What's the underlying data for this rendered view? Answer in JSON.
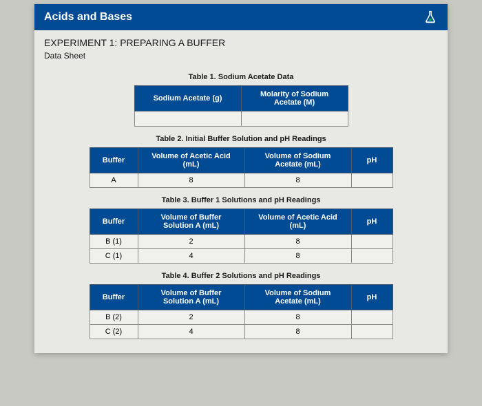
{
  "header": {
    "title": "Acids and Bases"
  },
  "experiment": {
    "heading": "EXPERIMENT 1: PREPARING A BUFFER",
    "datasheet": "Data Sheet"
  },
  "table1": {
    "caption": "Table 1. Sodium Acetate Data",
    "col1": "Sodium Acetate (g)",
    "col2": "Molarity of Sodium Acetate (M)",
    "r1c1": "",
    "r1c2": ""
  },
  "table2": {
    "caption": "Table 2. Initial Buffer Solution and pH Readings",
    "h_buffer": "Buffer",
    "h_c2": "Volume of Acetic Acid (mL)",
    "h_c3": "Volume of Sodium Acetate (mL)",
    "h_ph": "pH",
    "rows": [
      {
        "buffer": "A",
        "c2": "8",
        "c3": "8",
        "ph": ""
      }
    ]
  },
  "table3": {
    "caption": "Table 3. Buffer 1 Solutions and pH Readings",
    "h_buffer": "Buffer",
    "h_c2": "Volume of Buffer Solution A (mL)",
    "h_c3": "Volume of Acetic Acid (mL)",
    "h_ph": "pH",
    "rows": [
      {
        "buffer": "B (1)",
        "c2": "2",
        "c3": "8",
        "ph": ""
      },
      {
        "buffer": "C (1)",
        "c2": "4",
        "c3": "8",
        "ph": ""
      }
    ]
  },
  "table4": {
    "caption": "Table 4. Buffer 2 Solutions and pH Readings",
    "h_buffer": "Buffer",
    "h_c2": "Volume of Buffer Solution A (mL)",
    "h_c3": "Volume of Sodium Acetate (mL)",
    "h_ph": "pH",
    "rows": [
      {
        "buffer": "B (2)",
        "c2": "2",
        "c3": "8",
        "ph": ""
      },
      {
        "buffer": "C (2)",
        "c2": "4",
        "c3": "8",
        "ph": ""
      }
    ]
  }
}
